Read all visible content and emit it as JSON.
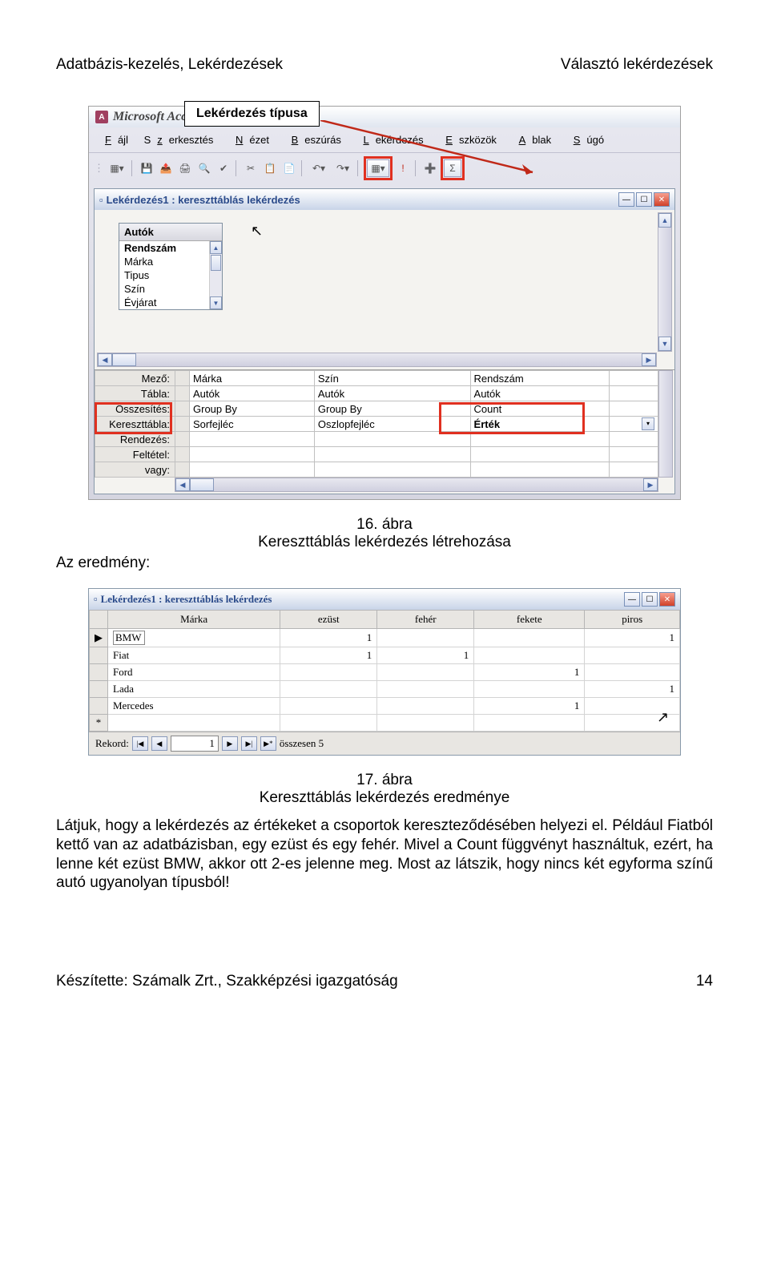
{
  "header": {
    "left": "Adatbázis-kezelés, Lekérdezések",
    "right": "Választó lekérdezések"
  },
  "callout": "Lekérdezés típusa",
  "app": {
    "title": "Microsoft Access",
    "menu": [
      "Fájl",
      "Szerkesztés",
      "Nézet",
      "Beszúrás",
      "Lekérdezés",
      "Eszközök",
      "Ablak",
      "Súgó"
    ]
  },
  "childWindow": {
    "title": "Lekérdezés1 : kereszttáblás lekérdezés"
  },
  "fieldBox": {
    "title": "Autók",
    "items": [
      "Rendszám",
      "Márka",
      "Tipus",
      "Szín",
      "Évjárat"
    ]
  },
  "designRows": [
    "Mező:",
    "Tábla:",
    "Összesítés:",
    "Kereszttábla:",
    "Rendezés:",
    "Feltétel:",
    "vagy:"
  ],
  "designCols": [
    [
      "Márka",
      "Autók",
      "Group By",
      "Sorfejléc",
      "",
      "",
      ""
    ],
    [
      "Szín",
      "Autók",
      "Group By",
      "Oszlopfejléc",
      "",
      "",
      ""
    ],
    [
      "Rendszám",
      "Autók",
      "Count",
      "Érték",
      "",
      "",
      ""
    ]
  ],
  "caption1": {
    "num": "16. ábra",
    "text": "Kereszttáblás lekérdezés létrehozása"
  },
  "resultLabel": "Az eredmény:",
  "resultHeaders": [
    "Márka",
    "ezüst",
    "fehér",
    "fekete",
    "piros"
  ],
  "resultRows": [
    {
      "m": "BMW",
      "v": [
        "1",
        "",
        "",
        "1"
      ]
    },
    {
      "m": "Fiat",
      "v": [
        "1",
        "1",
        "",
        ""
      ]
    },
    {
      "m": "Ford",
      "v": [
        "",
        "",
        "1",
        ""
      ]
    },
    {
      "m": "Lada",
      "v": [
        "",
        "",
        "",
        "1"
      ]
    },
    {
      "m": "Mercedes",
      "v": [
        "",
        "",
        "1",
        ""
      ]
    }
  ],
  "nav": {
    "label": "Rekord:",
    "value": "1",
    "total": "összesen 5"
  },
  "caption2": {
    "num": "17. ábra",
    "text": "Kereszttáblás lekérdezés eredménye"
  },
  "bodyText": "Látjuk, hogy a lekérdezés az értékeket a csoportok kereszteződésében helyezi el. Például Fiatból kettő van az adatbázisban, egy ezüst és egy fehér. Mivel a Count függvényt használtuk, ezért, ha lenne két ezüst BMW, akkor ott 2-es jelenne meg. Most az látszik, hogy nincs két egyforma színű autó ugyanolyan típusból!",
  "footer": {
    "left": "Készítette: Számalk Zrt., Szakképzési igazgatóság",
    "right": "14"
  }
}
